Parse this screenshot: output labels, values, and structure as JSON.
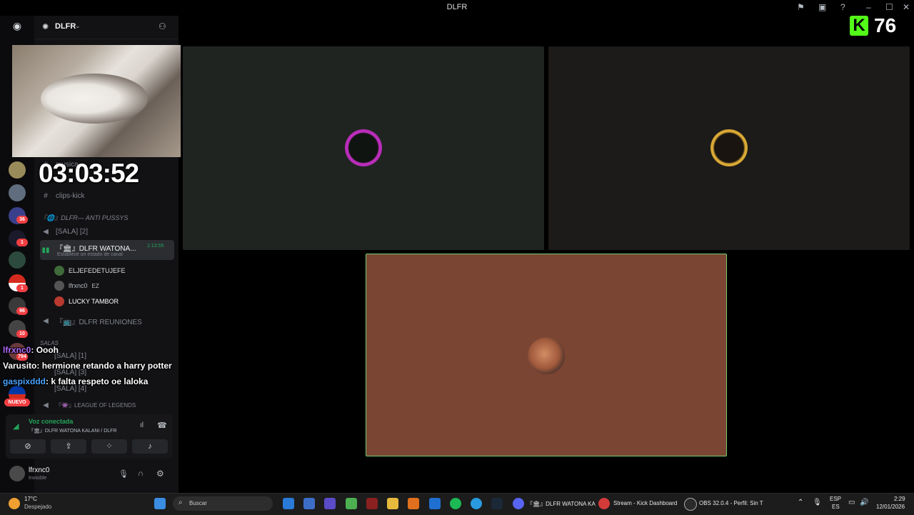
{
  "window": {
    "title": "DLFR"
  },
  "server": {
    "name": "DLFR"
  },
  "kick": {
    "viewer_count": "76"
  },
  "stream_overlay": {
    "timer": "03:03:52"
  },
  "channels": {
    "musica": "musica",
    "clips": "clips-kick",
    "category_1": "『🌐』DLFR— ANTI PUSSYS",
    "sala2": "[SALA] [2]",
    "active_voice": "『🏛』DLFR WATONA...",
    "active_voice_time": "1:13:55",
    "active_status": "Establece un estado de canal",
    "members": [
      "ELJEFEDETUJEFE",
      "lfrxnc0",
      "LUCKY TAMBOR"
    ],
    "member2_tag": "EZ",
    "reuniones": "『📺』DLFR REUNIONES",
    "category_2": "SALAS",
    "sala1": "[SALA] [1]",
    "sala3": "[SALA] [3]",
    "sala4": "[SALA] [4]",
    "lol": "『👾』LEAGUE OF LEGENDS"
  },
  "chat": [
    {
      "user": "lfrxnc0",
      "text": ": Oooh",
      "color": "#b36cff"
    },
    {
      "user": "Varusito",
      "text": ": hermione retando a harry potter",
      "color": "#ffffff"
    },
    {
      "user": "gaspixddd",
      "text": ": k falta respeto oe laloka",
      "color": "#4aa3ff"
    }
  ],
  "voice": {
    "status": "Voz conectada",
    "channel": "『🏛』DLFR WATONA KALANI / DLFR"
  },
  "user": {
    "name": "lfrxnc0",
    "status": "Invisible"
  },
  "rail_badges": [
    "36",
    "1",
    "1",
    "96",
    "10",
    "794"
  ],
  "rail_new": "NUEVO",
  "taskbar": {
    "weather_temp": "17°C",
    "weather_desc": "Despejado",
    "search": "Buscar",
    "app_discord": "『🏛』DLFR WATONA KA",
    "app_kick": "Stream - Kick Dashboard",
    "app_obs": "OBS 32.0.4 - Perfil: Sin T",
    "lang": "ESP",
    "lang2": "ES",
    "time": "2:29",
    "date": "12/01/2026"
  },
  "colors": {
    "kick_green": "#53fc18",
    "speaking_border": "#6fcf6f",
    "voice_green": "#23a55a"
  }
}
